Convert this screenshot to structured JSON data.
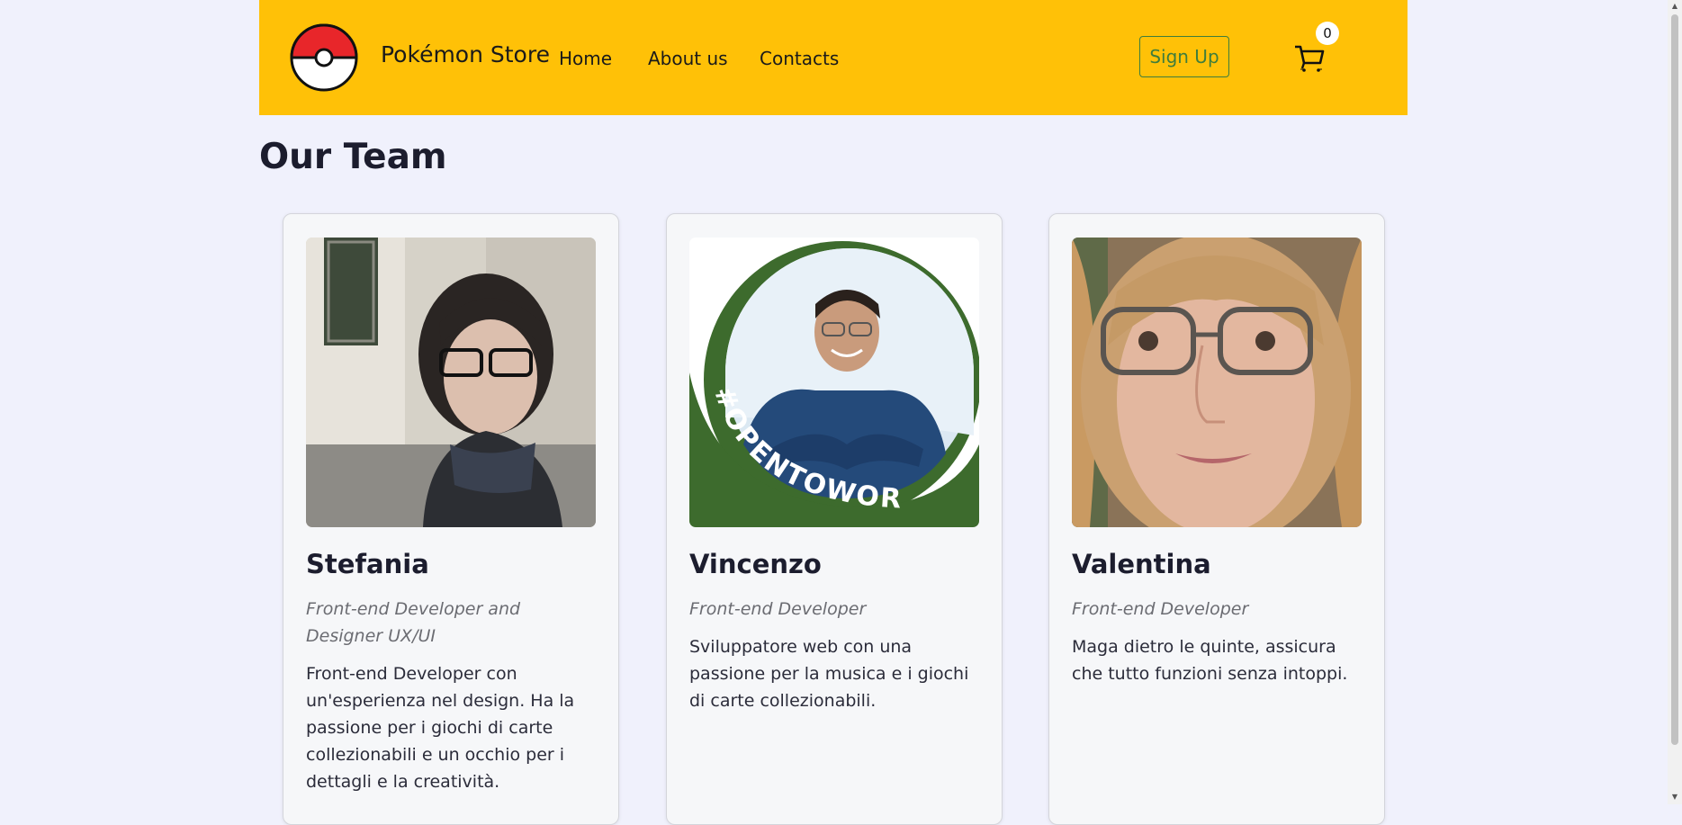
{
  "navbar": {
    "brand": "Pokémon Store",
    "links": [
      "Home",
      "About us",
      "Contacts"
    ],
    "signup_label": "Sign Up",
    "cart_count": "0",
    "logo_icon": "pokeball-icon",
    "cart_icon": "cart-icon"
  },
  "page": {
    "title": "Our Team"
  },
  "team": [
    {
      "name": "Stefania",
      "role": "Front-end Developer and Designer UX/UI",
      "bio": "Front-end Developer con un'esperienza nel design. Ha la passione per i giochi di carte collezionabili e un occhio per i dettagli e la creatività."
    },
    {
      "name": "Vincenzo",
      "role": "Front-end Developer",
      "bio": "Sviluppatore web con una passione per la musica e i giochi di carte collezionabili.",
      "photo_banner": "#OPENTOWORK"
    },
    {
      "name": "Valentina",
      "role": "Front-end Developer",
      "bio": "Maga dietro le quinte, assicura che tutto funzioni senza intoppi."
    }
  ],
  "colors": {
    "navbar": "#ffc107",
    "background": "#f0f1fc",
    "signup": "#3f7d3c",
    "opentowork": "#3b6b2f"
  }
}
